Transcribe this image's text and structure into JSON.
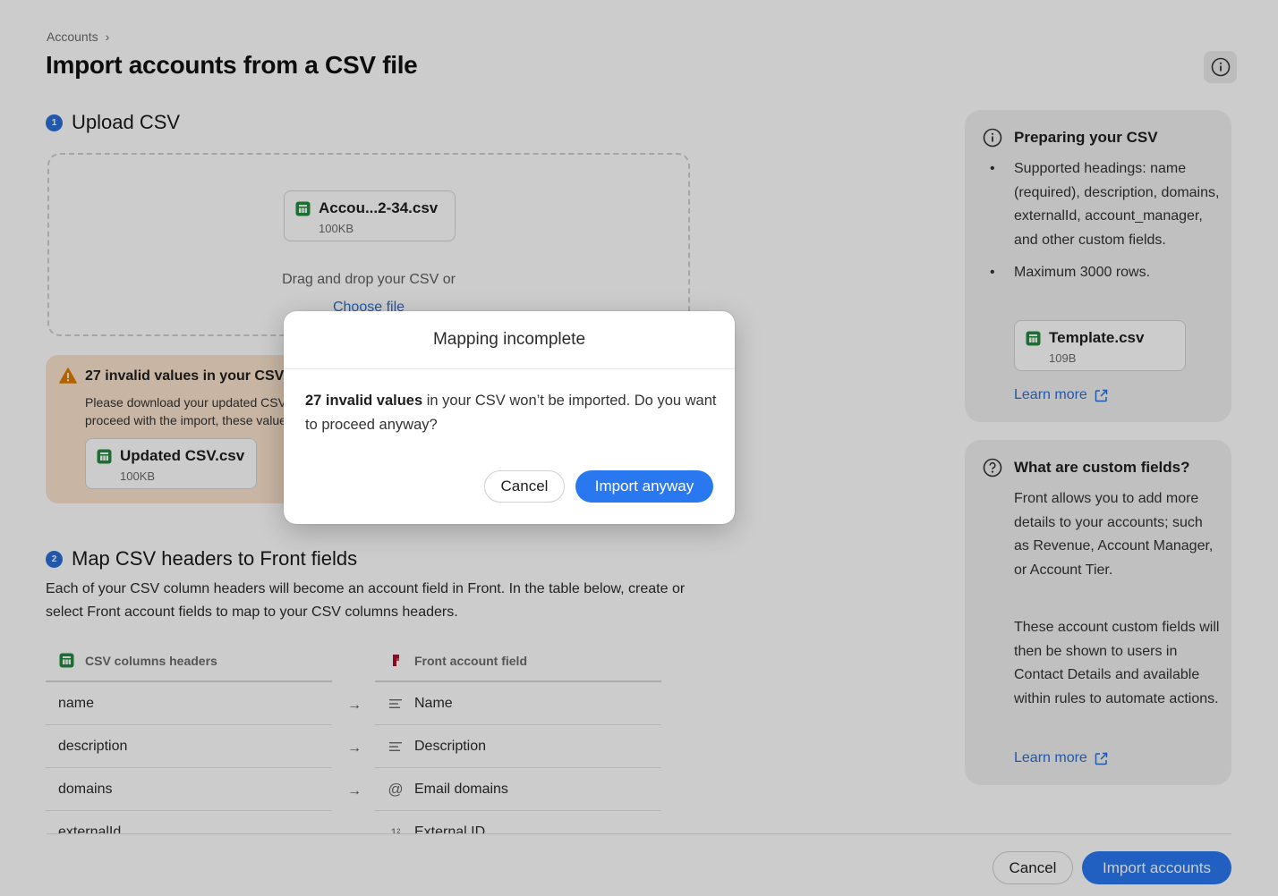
{
  "breadcrumb": {
    "label": "Accounts",
    "chevron": "›"
  },
  "page": {
    "title": "Import accounts from a CSV file"
  },
  "upload": {
    "step": "1",
    "heading": "Upload CSV",
    "file": {
      "name": "Accou...2-34.csv",
      "size": "100KB"
    },
    "drop_text": "Drag and drop your CSV or",
    "choose_link": "Choose file"
  },
  "warning": {
    "title": "27 invalid values in your CSV",
    "text": "Please download your updated CSV to see the invalid values in the “Validation error” column. If you proceed with the import, these values won’t be imported.",
    "file": {
      "name": "Updated CSV.csv",
      "size": "100KB"
    }
  },
  "mapping": {
    "step": "2",
    "heading": "Map CSV headers to Front fields",
    "description": "Each of your CSV column headers will become an account field in Front. In the table below, create or select Front account fields to map to your CSV columns headers.",
    "col_csv": "CSV columns headers",
    "col_front": "Front account field",
    "arrow": "→",
    "rows": [
      {
        "csv": "name",
        "front": "Name",
        "icon": "text-lines-icon"
      },
      {
        "csv": "description",
        "front": "Description",
        "icon": "text-lines-icon"
      },
      {
        "csv": "domains",
        "front": "Email domains",
        "icon": "at-icon"
      },
      {
        "csv": "externalId",
        "front": "External ID",
        "icon": "number-icon"
      }
    ]
  },
  "sidebar": {
    "preparing": {
      "title": "Preparing your CSV",
      "bullets": [
        "Supported headings: name (required), description, domains, externalId, account_manager, and other custom fields.",
        "Maximum 3000 rows."
      ],
      "file": {
        "name": "Template.csv",
        "size": "109B"
      },
      "learn_more": "Learn more"
    },
    "custom": {
      "title": "What are custom fields?",
      "para1": "Front allows you to add more details to your accounts; such as Revenue, Account Manager, or Account Tier.",
      "para2": "These account custom fields will then be shown to users in Contact Details and available within rules to automate actions.",
      "learn_more": "Learn more"
    }
  },
  "footer": {
    "cancel": "Cancel",
    "import": "Import accounts"
  },
  "modal": {
    "title": "Mapping incomplete",
    "body_bold": "27 invalid values",
    "body_rest": " in your CSV won’t be imported. Do you want to proceed anyway?",
    "cancel": "Cancel",
    "confirm": "Import anyway"
  },
  "colors": {
    "accent": "#2a78f0",
    "warning_bg": "#fbe3cc",
    "warning_icon": "#e07b00",
    "csv_green": "#1e8e3e"
  }
}
